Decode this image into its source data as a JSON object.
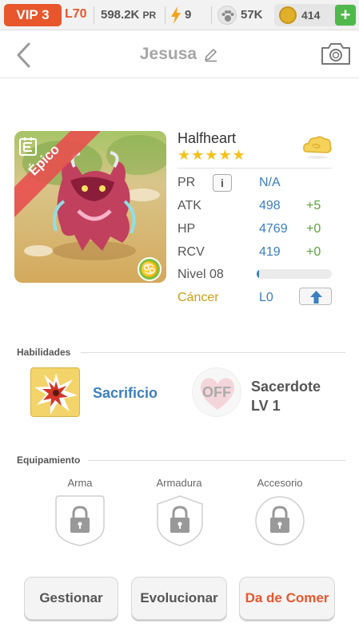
{
  "topbar": {
    "vip": "VIP 3",
    "level": "L70",
    "power_value": "598.2K",
    "power_unit": "PR",
    "energy": "9",
    "food": "57K",
    "coins": "414",
    "plus_label": "+"
  },
  "header": {
    "title": "Jesusa"
  },
  "hero": {
    "rarity": "Épico",
    "name": "Halfheart",
    "stars": "★★★★★",
    "zodiac_symbol": "♋",
    "info_label": "i",
    "stats": {
      "pr_label": "PR",
      "pr_value": "N/A",
      "atk_label": "ATK",
      "atk_value": "498",
      "atk_bonus": "+5",
      "hp_label": "HP",
      "hp_value": "4769",
      "hp_bonus": "+0",
      "rcv_label": "RCV",
      "rcv_value": "419",
      "rcv_bonus": "+0",
      "level_label": "Nivel 08",
      "xp_fraction": 0.03,
      "zodiac_label": "Cáncer",
      "zodiac_level": "L0"
    }
  },
  "skills": {
    "section_title": "Habilidades",
    "active_name": "Sacrificio",
    "passive_state": "OFF",
    "passive_name": "Sacerdote",
    "passive_level": "LV 1"
  },
  "equipment": {
    "section_title": "Equipamiento",
    "weapon_label": "Arma",
    "armor_label": "Armadura",
    "accessory_label": "Accesorio"
  },
  "actions": {
    "manage_label": "Gestionar",
    "evolve_label": "Evolucionar",
    "feed_label": "Da de Comer"
  },
  "colors": {
    "accent_orange": "#e8562c",
    "stat_blue": "#3c7fc0",
    "bonus_green": "#5aa63c",
    "star_gold": "#f4c21a",
    "zodiac_gold": "#c8a014"
  }
}
